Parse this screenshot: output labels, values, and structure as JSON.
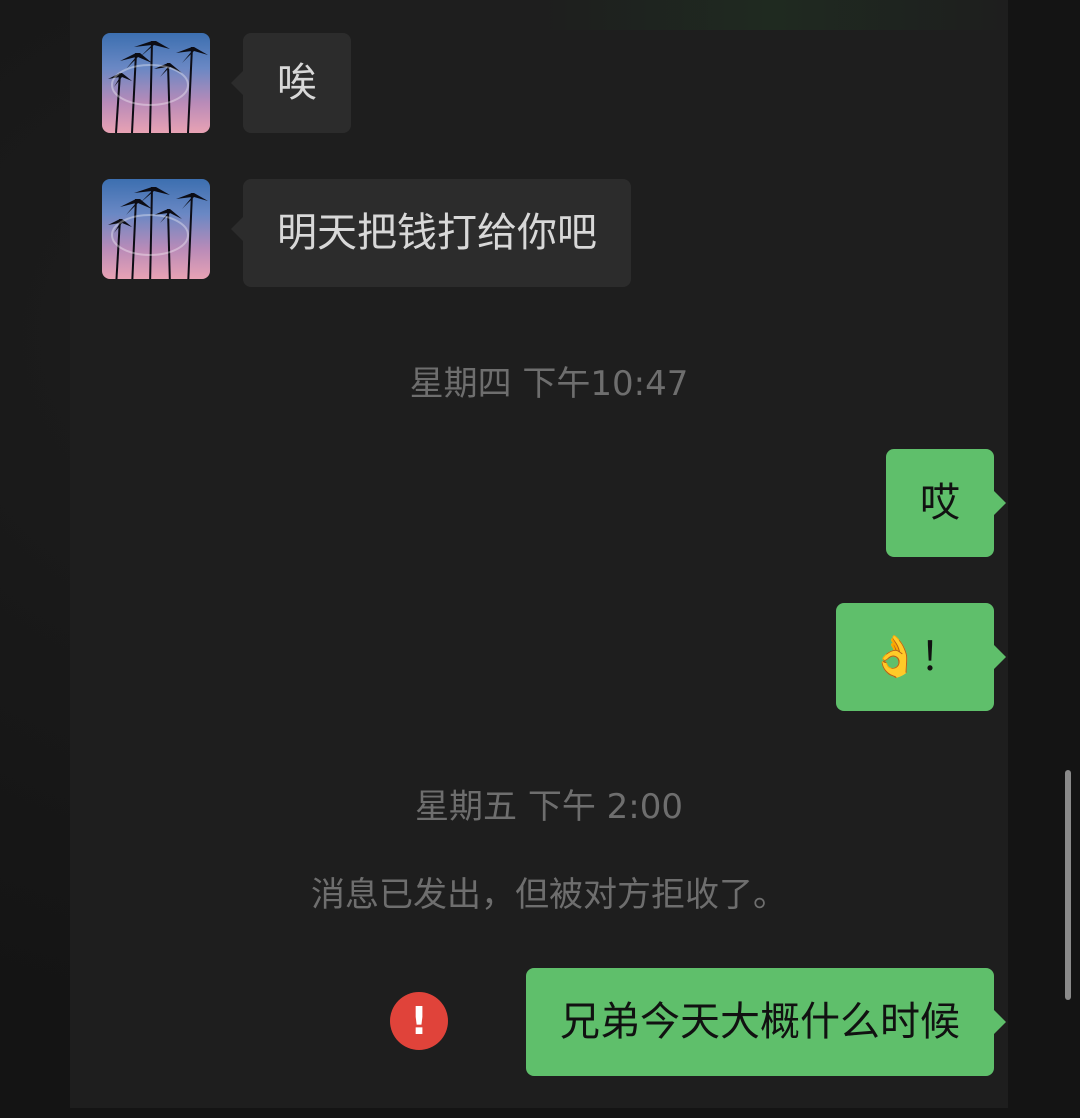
{
  "messages": {
    "incoming_1": "唉",
    "incoming_2": "明天把钱打给你吧",
    "timestamp_1": "星期四 下午10:47",
    "outgoing_1": "哎",
    "outgoing_2": "👌！",
    "timestamp_2": "星期五 下午 2:00",
    "system_note": "消息已发出，但被对方拒收了。",
    "outgoing_3": "兄弟今天大概什么时候",
    "error_symbol": "!"
  },
  "colors": {
    "incoming_bubble": "#2c2c2c",
    "outgoing_bubble": "#5fbf6b",
    "error": "#e0433a"
  },
  "icons": {
    "contact_avatar": "palm-trees-sunset-avatar",
    "send_failed": "exclamation-circle-icon"
  }
}
